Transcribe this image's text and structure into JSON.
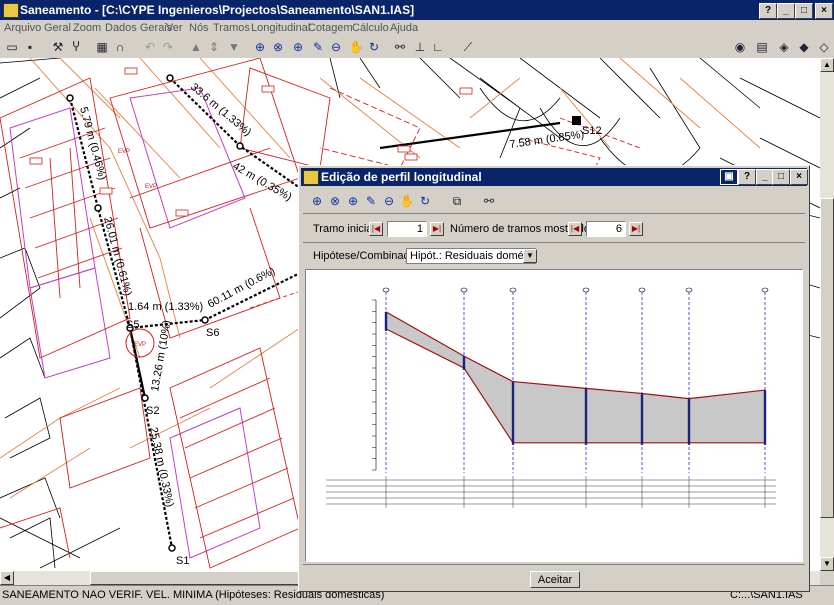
{
  "window": {
    "title": "Saneamento - [C:\\CYPE Ingenieros\\Projectos\\Saneamento\\SAN1.IAS]",
    "buttons": [
      "?",
      "_",
      "□",
      "×"
    ]
  },
  "menu": [
    "Arquivo",
    "Geral",
    "Zoom",
    "Dados Gerais",
    "Ver",
    "Nós",
    "Tramos",
    "Longitudinal",
    "Cotagem",
    "Cálculo",
    "Ajuda"
  ],
  "map_labels": {
    "s12": "S12",
    "s6": "S6",
    "s5": "S5",
    "s2": "S2",
    "s1": "S1",
    "seg1": "33.6 m (1.33%)",
    "seg2": "42 m (0.35%)",
    "seg3": "1.64 m (1.33%)",
    "seg4": "60.11 m (0.6%)",
    "seg5": "5.79 m (0.46%)",
    "seg6": "26.01 m (0.61%)",
    "seg7": "25.38 m (0.33%)",
    "seg8": "13.26 m (10%)",
    "seg9": "7.58 m (0.85%)",
    "evp1": "EVP",
    "evp2": "EVP",
    "evp3": "EVP"
  },
  "status": {
    "text": "SANEAMENTO NAO VERIF. VEL. MINIMA (Hipóteses: Residuais domésticas)",
    "right": "C:...\\SAN1.IAS"
  },
  "dialog": {
    "title": "Edição de perfil longitudinal",
    "buttons": [
      "?",
      "_",
      "□",
      "×"
    ],
    "tramo_inicial_label": "Tramo inicial",
    "tramo_inicial_value": "1",
    "numero_label": "Número de tramos mostrados",
    "numero_value": "6",
    "hipotese_label": "Hipótese/Combinação",
    "hipotese_value": "Hipót.: Residuais domésticas",
    "accept": "Aceitar"
  },
  "chart_data": {
    "type": "area",
    "x": [
      0,
      1,
      2,
      3,
      4,
      5,
      6
    ],
    "series": [
      {
        "values": [
          93,
          67,
          52,
          48,
          45,
          42,
          47
        ]
      },
      {
        "values": [
          83,
          60,
          16,
          16,
          16,
          16,
          16
        ]
      }
    ],
    "ylim": [
      0,
      100
    ]
  },
  "colors": {
    "titlebar": "#0a246a",
    "pipe_fill": "#c8c8c8",
    "pipe_wall": "#1a237e",
    "station_line": "#2a2ad0",
    "map_red": "#d02020",
    "map_magenta": "#c040c0",
    "map_orange": "#e08040"
  }
}
